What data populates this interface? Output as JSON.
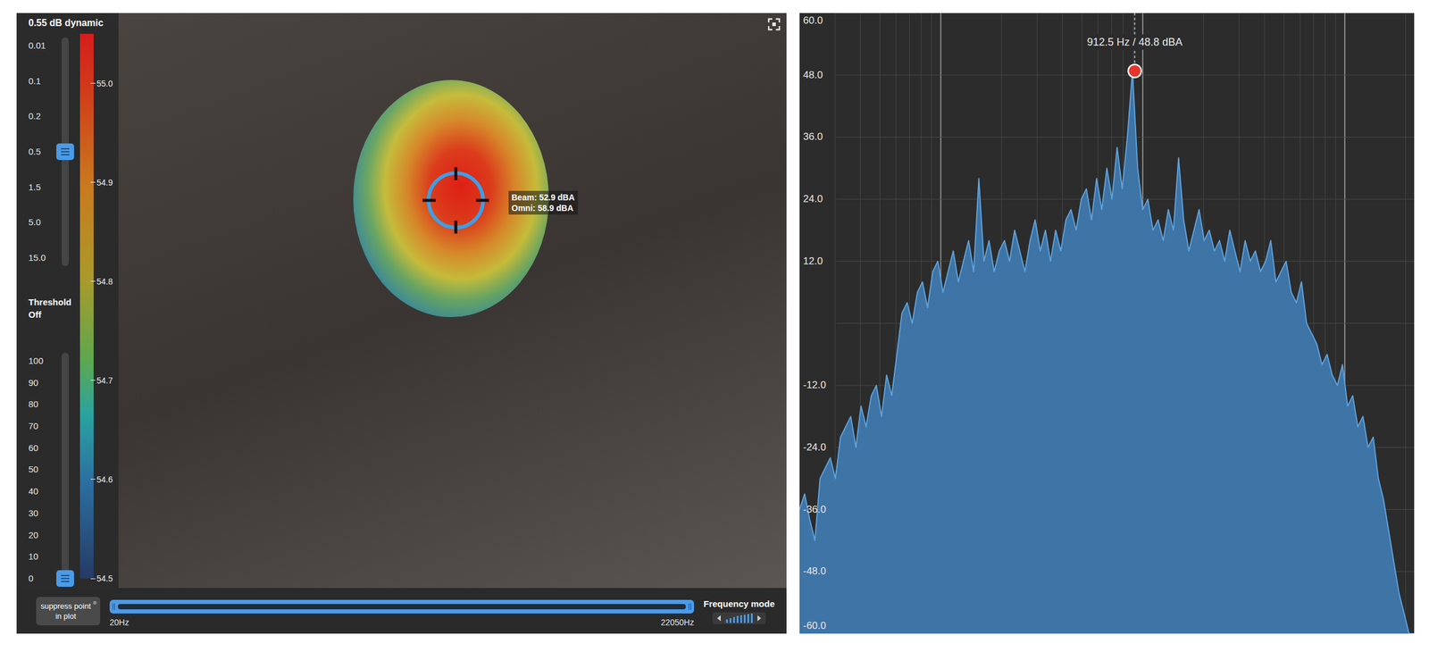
{
  "camera_view": {
    "dynamic": {
      "title": "0.55 dB dynamic",
      "ticks": [
        "0.01",
        "0.1",
        "0.2",
        "0.5",
        "1.5",
        "5.0",
        "15.0"
      ],
      "level": 0.5
    },
    "threshold": {
      "title": "Threshold Off",
      "ticks": [
        "100",
        "90",
        "80",
        "70",
        "60",
        "50",
        "40",
        "30",
        "20",
        "10",
        "0"
      ],
      "level": 0
    },
    "color_scale": {
      "range": [
        54.5,
        55.05
      ],
      "ticks": [
        {
          "value": 55.0,
          "label": "55.0"
        },
        {
          "value": 54.9,
          "label": "54.9"
        },
        {
          "value": 54.8,
          "label": "54.8"
        },
        {
          "value": 54.7,
          "label": "54.7"
        },
        {
          "value": 54.6,
          "label": "54.6"
        },
        {
          "value": 54.5,
          "label": "54.5"
        }
      ]
    },
    "hotspot": {
      "beam": "Beam: 52.9 dBA",
      "omni": "Omni: 58.9 dBA"
    },
    "suppress_button": {
      "label": "suppress point in plot",
      "on": false
    },
    "frequency_range": {
      "min_label": "20Hz",
      "max_label": "22050Hz",
      "low": 0,
      "high": 1
    },
    "frequency_mode": {
      "label": "Frequency mode"
    }
  },
  "spectrum": {
    "x_range": [
      20,
      22050
    ],
    "y_range": [
      -60,
      60
    ],
    "grid_step": 12,
    "ticks": [
      {
        "value": 60,
        "label": "60.0"
      },
      {
        "value": 48,
        "label": "48.0"
      },
      {
        "value": 36,
        "label": "36.0"
      },
      {
        "value": 24,
        "label": "24.0"
      },
      {
        "value": 12,
        "label": "12.0"
      },
      {
        "value": -12,
        "label": "-12.0"
      },
      {
        "value": -24,
        "label": "-24.0"
      },
      {
        "value": -36,
        "label": "-36.0"
      },
      {
        "value": -48,
        "label": "-48.0"
      },
      {
        "value": -60,
        "label": "-60.0"
      }
    ],
    "peak": {
      "label": "912.5 Hz / 48.8 dBA",
      "freq_hz": 912.5,
      "value": 48.8
    },
    "series": [
      {
        "values": [
          -36,
          -33,
          -38,
          -42,
          -30,
          -28,
          -26,
          -30,
          -22,
          -20,
          -18,
          -24,
          -16,
          -20,
          -14,
          -12,
          -18,
          -10,
          -14,
          -6,
          2,
          4,
          0,
          6,
          8,
          3,
          10,
          12,
          6,
          10,
          14,
          8,
          12,
          16,
          10,
          28,
          12,
          16,
          10,
          14,
          16,
          12,
          18,
          14,
          10,
          16,
          20,
          14,
          18,
          12,
          18,
          14,
          20,
          22,
          18,
          24,
          26,
          20,
          28,
          22,
          30,
          24,
          34,
          26,
          36,
          48.8,
          30,
          22,
          24,
          18,
          20,
          16,
          22,
          18,
          32,
          20,
          14,
          18,
          22,
          16,
          18,
          14,
          16,
          12,
          18,
          14,
          10,
          16,
          12,
          14,
          10,
          12,
          16,
          8,
          10,
          12,
          6,
          4,
          8,
          0,
          -2,
          -4,
          -8,
          -6,
          -10,
          -12,
          -8,
          -16,
          -14,
          -20,
          -18,
          -24,
          -22,
          -30,
          -34,
          -40,
          -46,
          -52,
          -56,
          -60,
          -60
        ]
      }
    ]
  }
}
